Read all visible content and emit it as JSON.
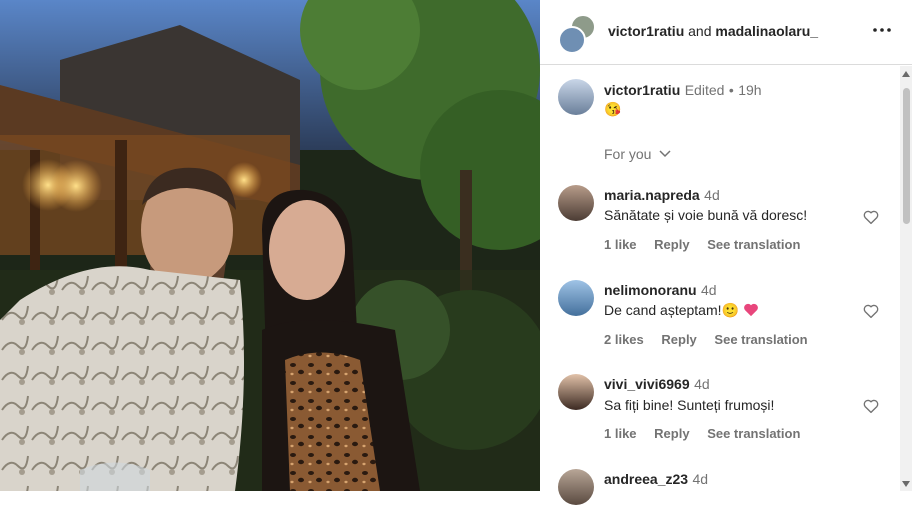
{
  "header": {
    "user1": "victor1ratiu",
    "joiner": "and",
    "user2": "madalinaolaru_"
  },
  "caption": {
    "username": "victor1ratiu",
    "edited": "Edited",
    "dot": "•",
    "time": "19h",
    "text": "😘"
  },
  "filter": {
    "label": "For you"
  },
  "comments": [
    {
      "username": "maria.napreda",
      "time": "4d",
      "text": "Sănătate și voie bună vă doresc!",
      "likes": "1 like",
      "reply": "Reply",
      "translate": "See translation"
    },
    {
      "username": "nelimonoranu",
      "time": "4d",
      "text": "De cand așteptam!",
      "emoji": "🙂",
      "likes": "2 likes",
      "reply": "Reply",
      "translate": "See translation"
    },
    {
      "username": "vivi_vivi6969",
      "time": "4d",
      "text": "Sa fiți bine! Sunteți frumoși!",
      "likes": "1 like",
      "reply": "Reply",
      "translate": "See translation"
    },
    {
      "username": "andreea_z23",
      "time": "4d"
    }
  ],
  "colors": {
    "heart_pink": "#e8467c",
    "muted": "#737373",
    "border": "#dbdbdb"
  }
}
